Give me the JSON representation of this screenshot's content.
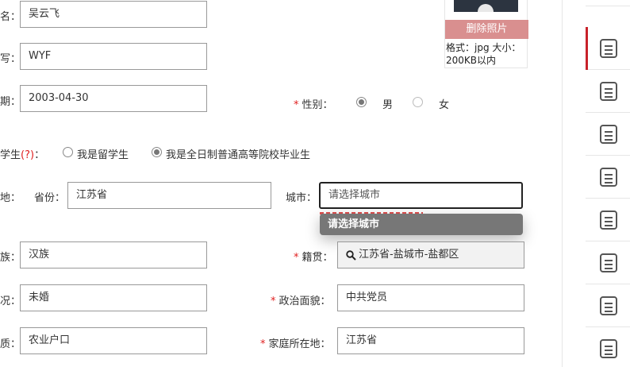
{
  "form": {
    "name_label": "名：",
    "name_value": "吴云飞",
    "abbr_label": "写：",
    "abbr_value": "WYF",
    "birth_label": "期：",
    "birth_value": "2003-04-30",
    "gender_label": "性别：",
    "gender_options": [
      "男",
      "女"
    ],
    "gender_selected": "男",
    "student_label": "学生",
    "student_help": "(?)",
    "student_colon": "：",
    "student_options": [
      "我是留学生",
      "我是全日制普通高等院校毕业生"
    ],
    "student_selected": "我是全日制普通高等院校毕业生",
    "origin_label": "地：",
    "province_label": "省份：",
    "province_value": "江苏省",
    "city_label": "城市：",
    "city_placeholder": "请选择城市",
    "city_dropdown_option": "请选择城市",
    "ethnicity_label": "族：",
    "ethnicity_value": "汉族",
    "native_label": "籍贯：",
    "native_value": "江苏省-盐城市-盐都区",
    "marital_label": "况：",
    "marital_value": "未婚",
    "political_label": "政治面貌：",
    "political_value": "中共党员",
    "hukou_label": "质：",
    "hukou_value": "农业户口",
    "home_label": "家庭所在地：",
    "home_value": "江苏省",
    "required_mark": "*"
  },
  "photo": {
    "delete_label": "删除照片",
    "format_line1": "格式：jpg 大小：",
    "format_line2": "200KB以内"
  },
  "sidebar": {
    "icon": "document-list-icon",
    "active_index": 0,
    "active_color": "#c8222a"
  }
}
